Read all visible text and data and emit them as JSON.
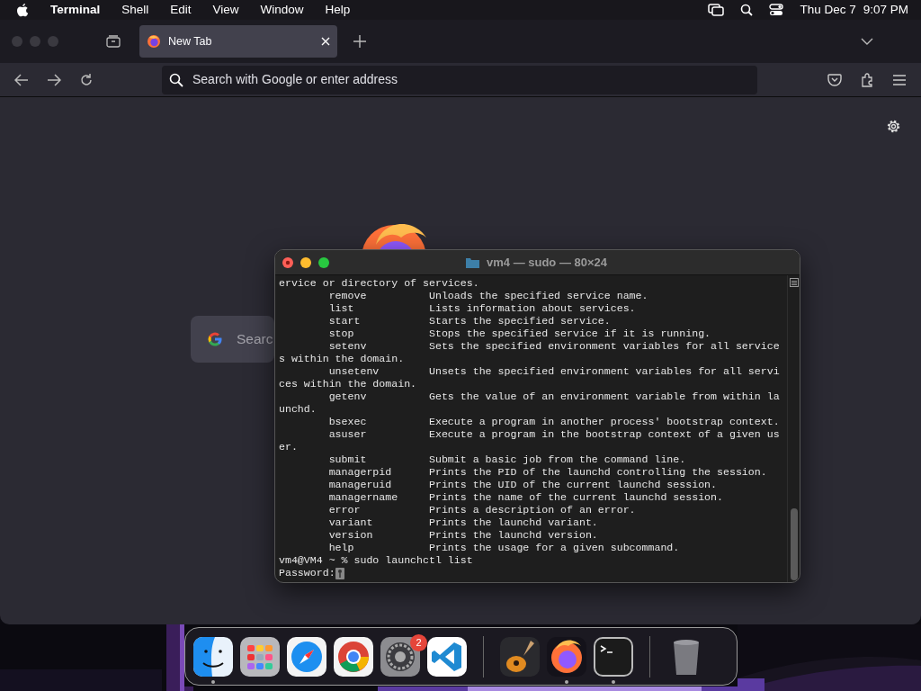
{
  "menu_bar": {
    "app": "Terminal",
    "menus": [
      "Shell",
      "Edit",
      "View",
      "Window",
      "Help"
    ],
    "date": "Thu Dec 7",
    "time": "9:07 PM"
  },
  "browser": {
    "tabs": [
      {
        "label": "New Tab",
        "selected": true
      }
    ],
    "address_placeholder": "Search with Google or enter address",
    "search_box": {
      "placeholder": "Searc"
    }
  },
  "terminal": {
    "title": "vm4 — sudo — 80×24",
    "lines": [
      "ervice or directory of services.",
      "        remove          Unloads the specified service name.",
      "        list            Lists information about services.",
      "        start           Starts the specified service.",
      "        stop            Stops the specified service if it is running.",
      "        setenv          Sets the specified environment variables for all service",
      "s within the domain.",
      "        unsetenv        Unsets the specified environment variables for all servi",
      "ces within the domain.",
      "        getenv          Gets the value of an environment variable from within la",
      "unchd.",
      "        bsexec          Execute a program in another process' bootstrap context.",
      "        asuser          Execute a program in the bootstrap context of a given us",
      "er.",
      "        submit          Submit a basic job from the command line.",
      "        managerpid      Prints the PID of the launchd controlling the session.",
      "        manageruid      Prints the UID of the current launchd session.",
      "        managername     Prints the name of the current launchd session.",
      "        error           Prints a description of an error.",
      "        variant         Prints the launchd variant.",
      "        version         Prints the launchd version.",
      "        help            Prints the usage for a given subcommand.",
      "vm4@VM4 ~ % sudo launchctl list"
    ],
    "password_prompt": "Password:"
  },
  "dock": {
    "items": [
      {
        "kind": "finder",
        "running": true
      },
      {
        "kind": "launchpad",
        "running": false
      },
      {
        "kind": "safari",
        "running": false
      },
      {
        "kind": "chrome",
        "running": false
      },
      {
        "kind": "settings",
        "running": false,
        "badge": "2"
      },
      {
        "kind": "vscode",
        "running": false
      },
      {
        "kind": "separator"
      },
      {
        "kind": "guitar",
        "running": false
      },
      {
        "kind": "firefox",
        "running": true
      },
      {
        "kind": "terminal",
        "running": true
      },
      {
        "kind": "separator"
      },
      {
        "kind": "trash",
        "running": false
      }
    ]
  }
}
